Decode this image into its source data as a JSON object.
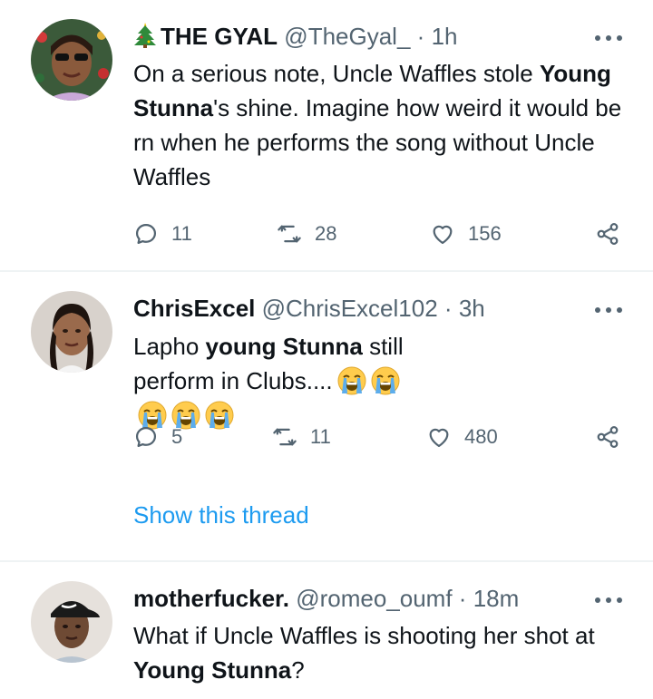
{
  "tweets": [
    {
      "name": "THE GYAL",
      "handle": "@TheGyal_",
      "sep": "·",
      "time": "1h",
      "text_parts": [
        "On a serious note, Uncle Waffles stole ",
        "Young Stunna",
        "'s shine. Imagine how weird it would be rn when he performs the song without Uncle Waffles"
      ],
      "replies": "11",
      "retweets": "28",
      "likes": "156"
    },
    {
      "name": "ChrisExcel",
      "handle": "@ChrisExcel102",
      "sep": "·",
      "time": "3h",
      "text_parts": [
        "Lapho ",
        "young Stunna",
        " still perform in Clubs...."
      ],
      "emoji": "loudly-crying-face",
      "emoji_count": 5,
      "replies": "5",
      "retweets": "11",
      "likes": "480",
      "show_thread": "Show this thread"
    },
    {
      "name": "motherfucker.",
      "handle": "@romeo_oumf",
      "sep": "·",
      "time": "18m",
      "text_parts": [
        "What if Uncle Waffles is shooting her shot at ",
        "Young Stunna",
        "?"
      ]
    }
  ],
  "icons": {
    "reply": "reply-icon",
    "retweet": "retweet-icon",
    "like": "heart-icon",
    "share": "share-icon",
    "more": "more-icon",
    "name_prefix": "christmas-tree-icon"
  },
  "colors": {
    "text": "#0f1419",
    "secondary": "#536471",
    "link": "#1d9bf0",
    "divider": "#eff3f4"
  }
}
